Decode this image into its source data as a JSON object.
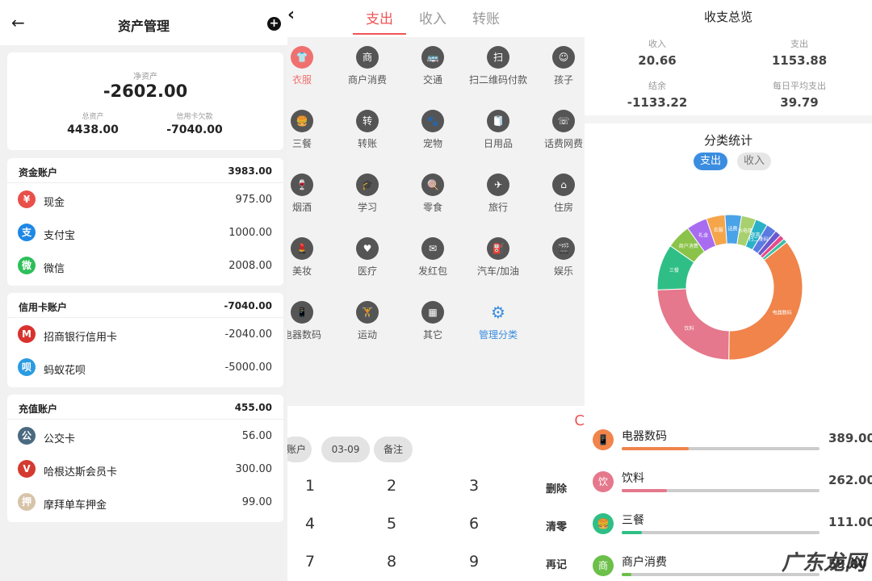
{
  "assets": {
    "title": "资产管理",
    "net_label": "净资产",
    "net_value": "-2602.00",
    "total_label": "总资产",
    "total_value": "4438.00",
    "debt_label": "信用卡欠款",
    "debt_value": "-7040.00",
    "groups": [
      {
        "name": "资金账户",
        "total": "3983.00",
        "items": [
          {
            "name": "现金",
            "amount": "975.00",
            "icon": "cash-icon",
            "color": "#e8504a",
            "glyph": "¥"
          },
          {
            "name": "支付宝",
            "amount": "1000.00",
            "icon": "alipay-icon",
            "color": "#1e88e5",
            "glyph": "支"
          },
          {
            "name": "微信",
            "amount": "2008.00",
            "icon": "wechat-icon",
            "color": "#2dbf5a",
            "glyph": "微"
          }
        ]
      },
      {
        "name": "信用卡账户",
        "total": "-7040.00",
        "items": [
          {
            "name": "招商银行信用卡",
            "amount": "-2040.00",
            "icon": "cmb-bank-icon",
            "color": "#d9322e",
            "glyph": "M"
          },
          {
            "name": "蚂蚁花呗",
            "amount": "-5000.00",
            "icon": "huabei-icon",
            "color": "#2b9be0",
            "glyph": "呗"
          }
        ]
      },
      {
        "name": "充值账户",
        "total": "455.00",
        "items": [
          {
            "name": "公交卡",
            "amount": "56.00",
            "icon": "bus-card-icon",
            "color": "#4b6a80",
            "glyph": "公"
          },
          {
            "name": "哈根达斯会员卡",
            "amount": "300.00",
            "icon": "haagen-dazs-icon",
            "color": "#d43a2f",
            "glyph": "V"
          },
          {
            "name": "摩拜单车押金",
            "amount": "99.00",
            "icon": "deposit-icon",
            "color": "#d7c4a8",
            "glyph": "押"
          }
        ]
      }
    ]
  },
  "record": {
    "tabs": [
      "支出",
      "收入",
      "转账"
    ],
    "categories": [
      {
        "label": "衣服",
        "icon": "clothes-icon",
        "glyph": "👕"
      },
      {
        "label": "商户消费",
        "icon": "merchant-icon",
        "glyph": "商"
      },
      {
        "label": "交通",
        "icon": "bus-icon",
        "glyph": "🚌"
      },
      {
        "label": "扫二维码付款",
        "icon": "scan-icon",
        "glyph": "扫"
      },
      {
        "label": "孩子",
        "icon": "child-icon",
        "glyph": "☺"
      },
      {
        "label": "三餐",
        "icon": "meal-icon",
        "glyph": "🍔"
      },
      {
        "label": "转账",
        "icon": "transfer-icon",
        "glyph": "转"
      },
      {
        "label": "宠物",
        "icon": "pet-icon",
        "glyph": "🐾"
      },
      {
        "label": "日用品",
        "icon": "daily-goods-icon",
        "glyph": "🧻"
      },
      {
        "label": "话费网费",
        "icon": "phone-bill-icon",
        "glyph": "☏"
      },
      {
        "label": "烟酒",
        "icon": "tobacco-wine-icon",
        "glyph": "🍷"
      },
      {
        "label": "学习",
        "icon": "study-icon",
        "glyph": "🎓"
      },
      {
        "label": "零食",
        "icon": "snack-icon",
        "glyph": "🍭"
      },
      {
        "label": "旅行",
        "icon": "travel-icon",
        "glyph": "✈"
      },
      {
        "label": "住房",
        "icon": "housing-icon",
        "glyph": "⌂"
      },
      {
        "label": "美妆",
        "icon": "makeup-icon",
        "glyph": "💄"
      },
      {
        "label": "医疗",
        "icon": "medical-icon",
        "glyph": "♥"
      },
      {
        "label": "发红包",
        "icon": "red-packet-icon",
        "glyph": "✉"
      },
      {
        "label": "汽车/加油",
        "icon": "fuel-icon",
        "glyph": "⛽"
      },
      {
        "label": "娱乐",
        "icon": "entertainment-icon",
        "glyph": "🎬"
      },
      {
        "label": "电器数码",
        "icon": "device-icon",
        "glyph": "📱"
      },
      {
        "label": "运动",
        "icon": "sport-icon",
        "glyph": "🏋"
      },
      {
        "label": "其它",
        "icon": "other-icon",
        "glyph": "▦"
      },
      {
        "label": "管理分类",
        "icon": "settings-gear-icon",
        "glyph": "⚙"
      }
    ],
    "chips": {
      "account": "账户",
      "date": "03-09",
      "note": "备注"
    },
    "keys": [
      "1",
      "2",
      "3",
      "删除",
      "4",
      "5",
      "6",
      "清零",
      "7",
      "8",
      "9",
      "再记"
    ],
    "ok_edge": "C"
  },
  "summary": {
    "title": "收支总览",
    "income_label": "收入",
    "income": "20.66",
    "expense_label": "支出",
    "expense": "1153.88",
    "balance_label": "结余",
    "balance": "-1133.22",
    "daily_label": "每日平均支出",
    "daily": "39.79",
    "stat_title": "分类统计",
    "switch_expense": "支出",
    "switch_income": "收入",
    "watermark": "广东龙网"
  },
  "chart_data": {
    "type": "pie",
    "donut": true,
    "slices": [
      {
        "label": "电器数码",
        "value": 389.0,
        "color": "#f0844a"
      },
      {
        "label": "饮料",
        "value": 262.0,
        "color": "#e5788c"
      },
      {
        "label": "三餐",
        "value": 111.0,
        "color": "#2fbf86"
      },
      {
        "label": "商户消费",
        "value": 59.0,
        "color": "#8bc34a"
      },
      {
        "label": "礼金",
        "value": 50.0,
        "color": "#a86cf0"
      },
      {
        "label": "衣服",
        "value": 45.0,
        "color": "#f5a54a"
      },
      {
        "label": "话费",
        "value": 40.0,
        "color": "#4aa3e8"
      },
      {
        "label": "水电煤",
        "value": 35.0,
        "color": "#a8d06e"
      },
      {
        "label": "夜宵",
        "value": 30.0,
        "color": "#2ab1c7"
      },
      {
        "label": "扫二维码付款",
        "value": 25.0,
        "color": "#5b7be0"
      },
      {
        "label": "",
        "value": 15.0,
        "color": "#6a5acd"
      },
      {
        "label": "",
        "value": 12.0,
        "color": "#e84a8a"
      },
      {
        "label": "",
        "value": 10.0,
        "color": "#3cc0a0"
      }
    ],
    "list": [
      {
        "label": "电器数码",
        "value": "389.00",
        "glyph": "📱",
        "color": "#f0844a",
        "share": 0.34
      },
      {
        "label": "饮料",
        "value": "262.00",
        "glyph": "饮",
        "color": "#e5788c",
        "share": 0.23
      },
      {
        "label": "三餐",
        "value": "111.00",
        "glyph": "🍔",
        "color": "#2fbf86",
        "share": 0.1
      },
      {
        "label": "商户消费",
        "value": "59.00",
        "glyph": "商",
        "color": "#6cc04a",
        "share": 0.05
      }
    ]
  }
}
